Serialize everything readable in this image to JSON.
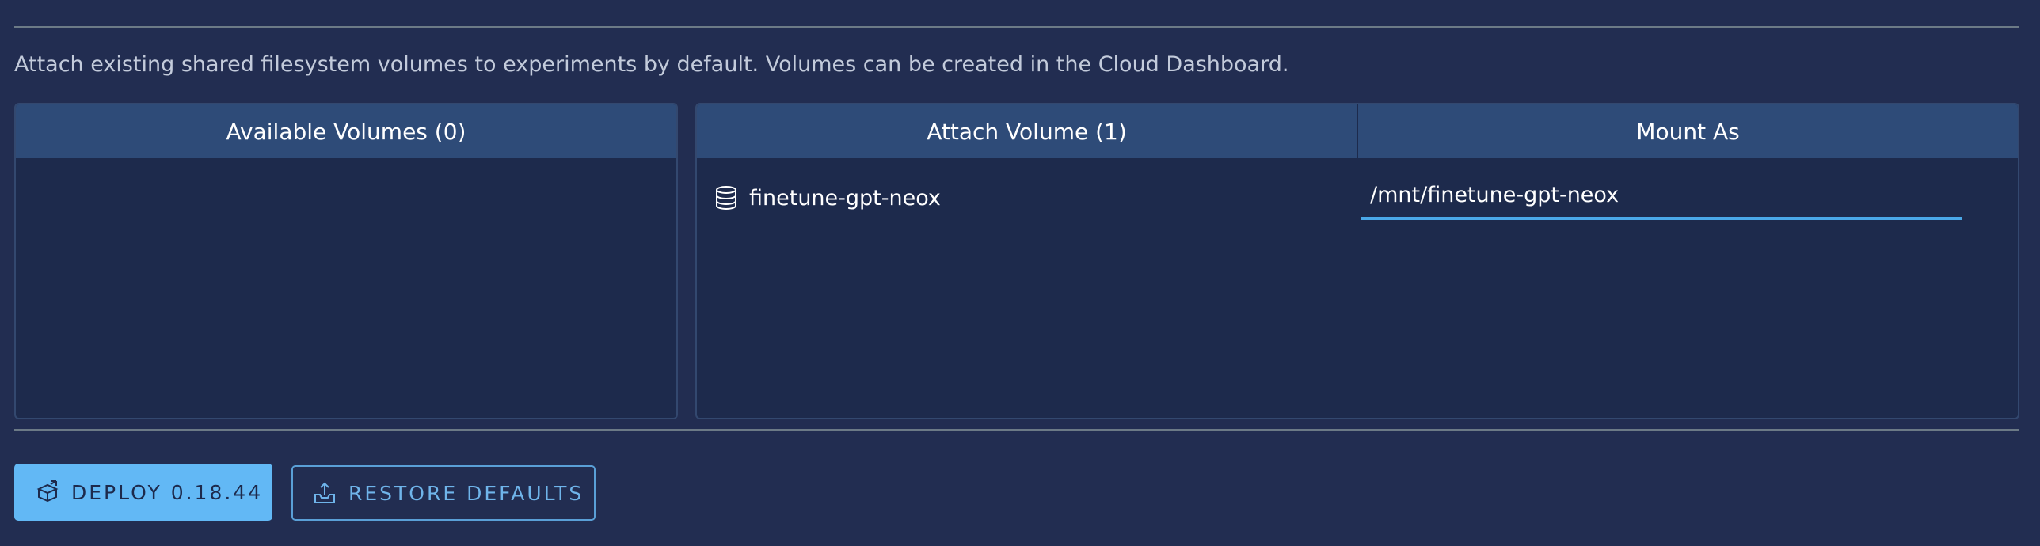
{
  "description": "Attach existing shared filesystem volumes to experiments by default. Volumes can be created in the Cloud Dashboard.",
  "available_panel": {
    "header": "Available Volumes (0)"
  },
  "attach_panel": {
    "header_attach": "Attach Volume (1)",
    "header_mount": "Mount As",
    "rows": [
      {
        "icon": "database-icon",
        "name": "finetune-gpt-neox",
        "mount_path": "/mnt/finetune-gpt-neox"
      }
    ]
  },
  "actions": {
    "deploy_label": "DEPLOY 0.18.44",
    "deploy_icon": "rocket-icon",
    "restore_label": "RESTORE DEFAULTS",
    "restore_icon": "upload-tray-icon"
  },
  "colors": {
    "background": "#222d51",
    "panel": "#1d2a4c",
    "header": "#2e4b78",
    "accent": "#62b8f5"
  }
}
